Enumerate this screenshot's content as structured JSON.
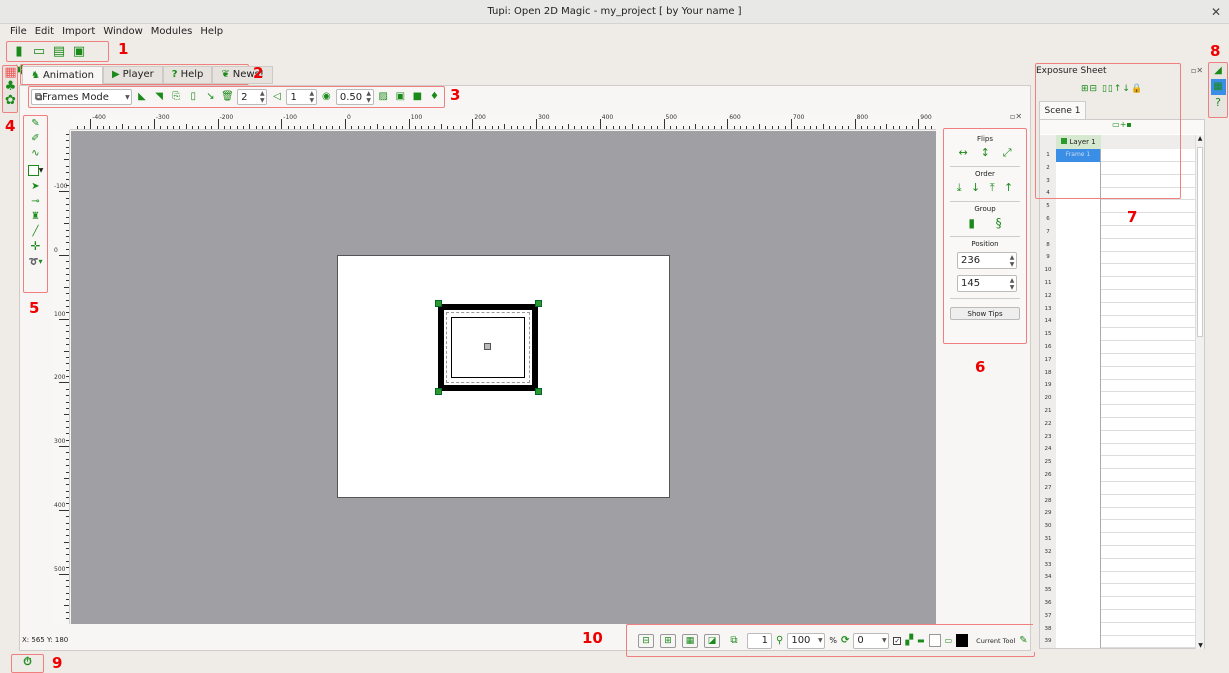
{
  "window": {
    "title": "Tupi: Open 2D Magic - my_project [ by Your name ]",
    "close": "✕"
  },
  "menu": [
    "File",
    "Edit",
    "Import",
    "Window",
    "Modules",
    "Help"
  ],
  "main_toolbar": {
    "icons": [
      "new-project-icon",
      "open-project-icon",
      "save-icon",
      "save-as-icon",
      "close-project-icon"
    ]
  },
  "tabs": [
    {
      "label": "Animation",
      "icon": "animation-icon",
      "active": true
    },
    {
      "label": "Player",
      "icon": "play-icon"
    },
    {
      "label": "Help",
      "icon": "help-icon"
    },
    {
      "label": "News!",
      "icon": "news-icon"
    }
  ],
  "frame_toolbar": {
    "mode": "Frames Mode",
    "previous_frames": "2",
    "next_frames": "1",
    "opacity": "0.50"
  },
  "ruler": {
    "h_labels": [
      "-400",
      "-300",
      "-200",
      "-100",
      "0",
      "100",
      "200",
      "300",
      "400",
      "500",
      "600",
      "700",
      "800",
      "900"
    ],
    "v_labels": [
      "-100",
      "0",
      "100",
      "200",
      "300",
      "400",
      "500"
    ]
  },
  "coords": "X: 565 Y: 180",
  "properties": {
    "flips": "Flips",
    "order": "Order",
    "group": "Group",
    "position": "Position",
    "x": "236",
    "y": "145",
    "show_tips": "Show Tips"
  },
  "exposure": {
    "title": "Exposure Sheet",
    "scene_tab": "Scene 1",
    "layer": "Layer 1",
    "frame": "Frame 1",
    "rows": 39
  },
  "bottom_toolbar": {
    "frame": "1",
    "zoom": "100",
    "zoom_unit": "%",
    "rotation": "0",
    "current_tool": "Current Tool"
  },
  "annotations": [
    "1",
    "2",
    "3",
    "4",
    "5",
    "6",
    "7",
    "8",
    "9",
    "10"
  ],
  "colors": {
    "accent": "#1a8a1a",
    "selection": "#3a8ee6",
    "annotation": "#e00000",
    "canvas_bg": "#a09fa3"
  }
}
